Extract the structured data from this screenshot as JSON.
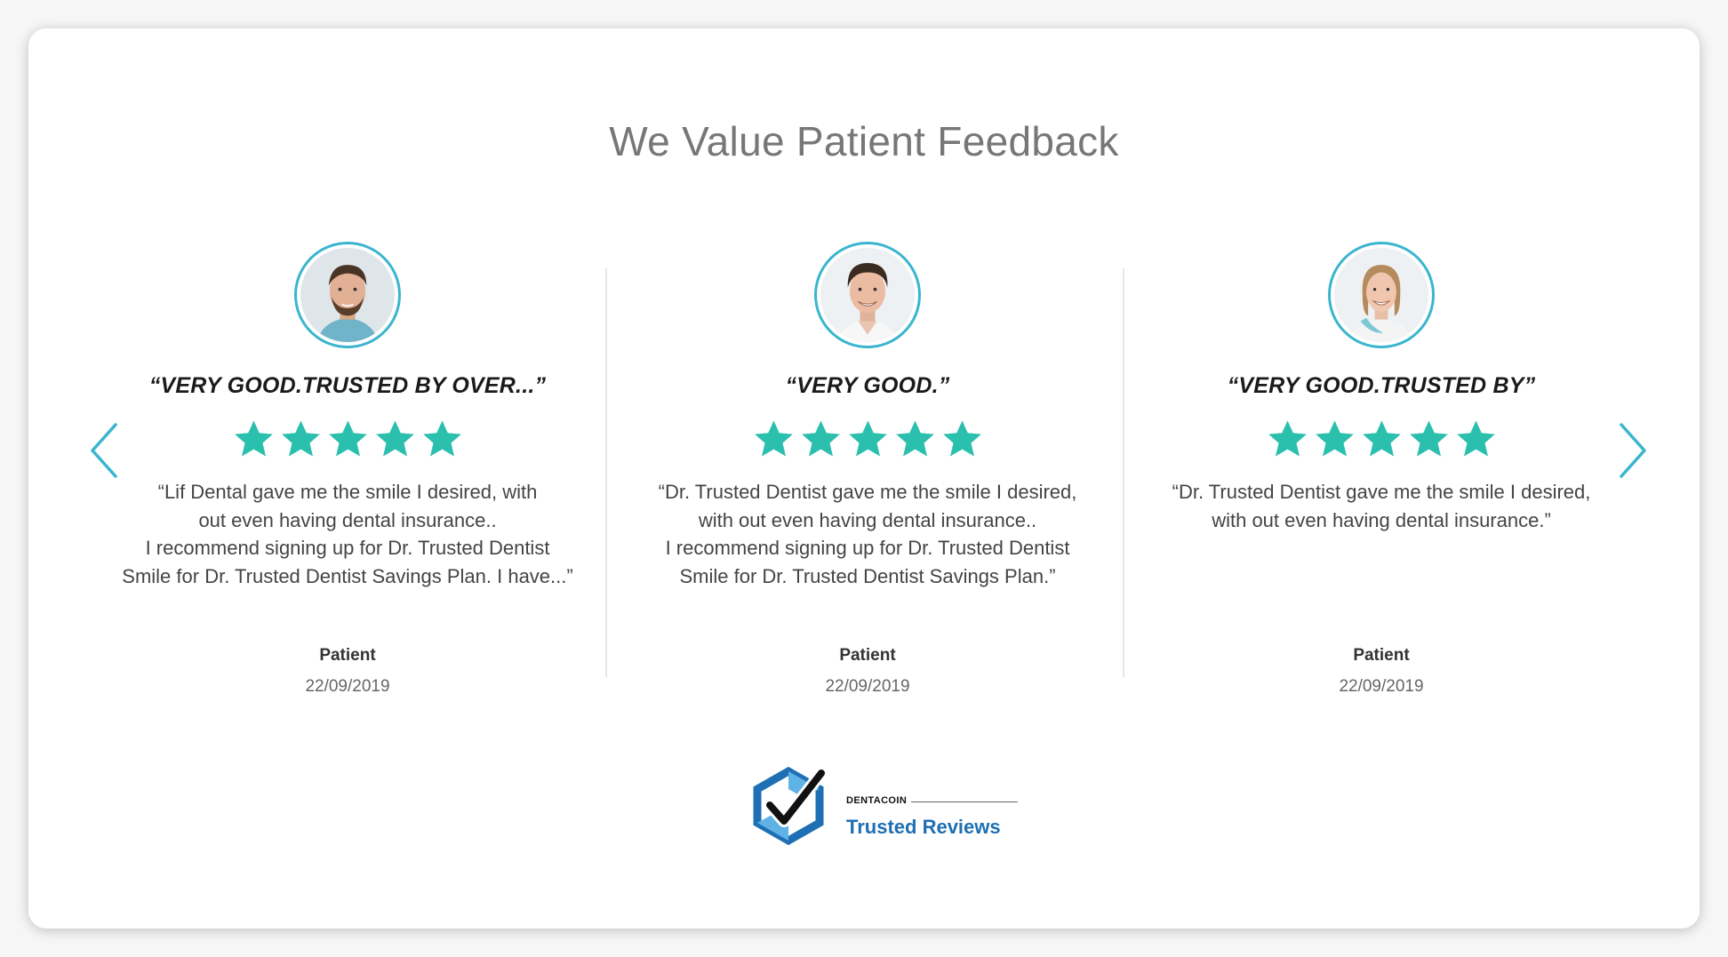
{
  "section": {
    "title": "We Value Patient Feedback"
  },
  "navigation": {
    "prev_icon": "chevron-left-icon",
    "next_icon": "chevron-right-icon"
  },
  "colors": {
    "accent": "#3ab5cf",
    "star": "#2bbfae",
    "brand_blue": "#1e6fb3"
  },
  "reviews": [
    {
      "headline": "“VERY GOOD.TRUSTED BY OVER...”",
      "rating": 5,
      "quote_lines": [
        "“Lif Dental gave me the smile I desired, with",
        "out even having dental insurance..",
        "I recommend signing up for Dr. Trusted Dentist",
        "Smile for Dr. Trusted Dentist Savings Plan. I have...”"
      ],
      "author": "Patient",
      "date": "22/09/2019"
    },
    {
      "headline": "“VERY GOOD.”",
      "rating": 5,
      "quote_lines": [
        "“Dr. Trusted Dentist gave me the smile I desired,",
        "with out even having dental insurance..",
        "I recommend signing up for Dr. Trusted Dentist",
        "Smile for Dr. Trusted Dentist Savings Plan.”"
      ],
      "author": "Patient",
      "date": "22/09/2019"
    },
    {
      "headline": "“VERY GOOD.TRUSTED BY”",
      "rating": 5,
      "quote_lines": [
        "“Dr. Trusted Dentist gave me the smile I desired,",
        "with out even having dental insurance.”"
      ],
      "author": "Patient",
      "date": "22/09/2019"
    }
  ],
  "footer_logo": {
    "brand": "DENTACOIN",
    "text": "Trusted Reviews"
  }
}
